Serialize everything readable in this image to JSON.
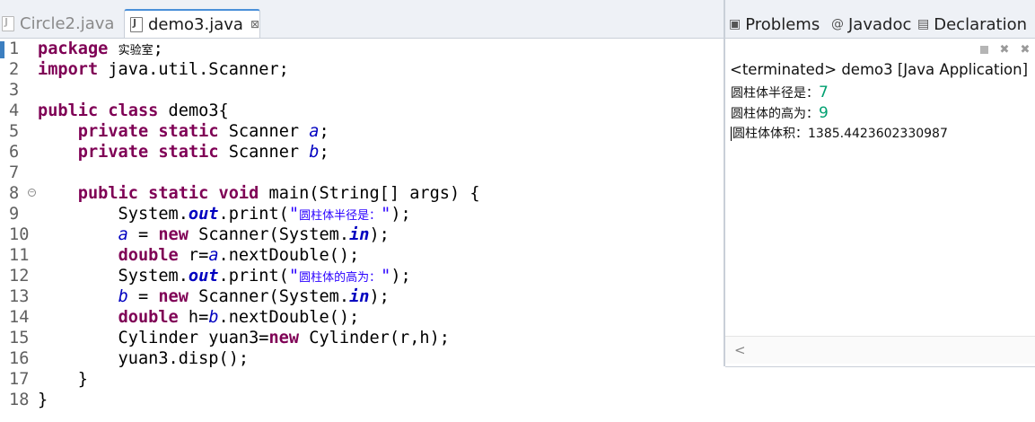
{
  "editor": {
    "tabs": [
      {
        "label": "Circle2.java",
        "icon": "java-file-icon",
        "active": false
      },
      {
        "label": "demo3.java",
        "icon": "java-file-icon",
        "active": true,
        "close": "⊠"
      }
    ],
    "lines": [
      {
        "n": "1",
        "segs": [
          [
            "kw",
            "package"
          ],
          [
            "t",
            " "
          ],
          [
            "cn",
            "实验室"
          ],
          [
            "t",
            ";"
          ]
        ]
      },
      {
        "n": "2",
        "segs": [
          [
            "kw",
            "import"
          ],
          [
            "t",
            " java.util.Scanner;"
          ]
        ]
      },
      {
        "n": "3",
        "segs": []
      },
      {
        "n": "4",
        "segs": [
          [
            "kw",
            "public"
          ],
          [
            "t",
            " "
          ],
          [
            "kw",
            "class"
          ],
          [
            "t",
            " demo3{"
          ]
        ]
      },
      {
        "n": "5",
        "segs": [
          [
            "t",
            "    "
          ],
          [
            "kw",
            "private"
          ],
          [
            "t",
            " "
          ],
          [
            "kw",
            "static"
          ],
          [
            "t",
            " Scanner "
          ],
          [
            "fld",
            "a"
          ],
          [
            "t",
            ";"
          ]
        ]
      },
      {
        "n": "6",
        "segs": [
          [
            "t",
            "    "
          ],
          [
            "kw",
            "private"
          ],
          [
            "t",
            " "
          ],
          [
            "kw",
            "static"
          ],
          [
            "t",
            " Scanner "
          ],
          [
            "fld",
            "b"
          ],
          [
            "t",
            ";"
          ]
        ]
      },
      {
        "n": "7",
        "segs": []
      },
      {
        "n": "8",
        "fold": true,
        "segs": [
          [
            "t",
            "    "
          ],
          [
            "kw",
            "public"
          ],
          [
            "t",
            " "
          ],
          [
            "kw",
            "static"
          ],
          [
            "t",
            " "
          ],
          [
            "kw",
            "void"
          ],
          [
            "t",
            " main(String[] args) {"
          ]
        ]
      },
      {
        "n": "9",
        "segs": [
          [
            "t",
            "        System."
          ],
          [
            "st",
            "out"
          ],
          [
            "t",
            ".print("
          ],
          [
            "str",
            "\""
          ],
          [
            "strcn",
            "圆柱体半径是："
          ],
          [
            "str",
            "\""
          ],
          [
            "t",
            ");"
          ]
        ]
      },
      {
        "n": "10",
        "segs": [
          [
            "t",
            "        "
          ],
          [
            "fld",
            "a"
          ],
          [
            "t",
            " = "
          ],
          [
            "kw",
            "new"
          ],
          [
            "t",
            " Scanner(System."
          ],
          [
            "st",
            "in"
          ],
          [
            "t",
            ");"
          ]
        ]
      },
      {
        "n": "11",
        "segs": [
          [
            "t",
            "        "
          ],
          [
            "kw",
            "double"
          ],
          [
            "t",
            " r="
          ],
          [
            "fld",
            "a"
          ],
          [
            "t",
            ".nextDouble();"
          ]
        ]
      },
      {
        "n": "12",
        "segs": [
          [
            "t",
            "        System."
          ],
          [
            "st",
            "out"
          ],
          [
            "t",
            ".print("
          ],
          [
            "str",
            "\""
          ],
          [
            "strcn",
            "圆柱体的高为："
          ],
          [
            "str",
            "\""
          ],
          [
            "t",
            ");"
          ]
        ]
      },
      {
        "n": "13",
        "segs": [
          [
            "t",
            "        "
          ],
          [
            "fld",
            "b"
          ],
          [
            "t",
            " = "
          ],
          [
            "kw",
            "new"
          ],
          [
            "t",
            " Scanner(System."
          ],
          [
            "st",
            "in"
          ],
          [
            "t",
            ");"
          ]
        ]
      },
      {
        "n": "14",
        "segs": [
          [
            "t",
            "        "
          ],
          [
            "kw",
            "double"
          ],
          [
            "t",
            " h="
          ],
          [
            "fld",
            "b"
          ],
          [
            "t",
            ".nextDouble();"
          ]
        ]
      },
      {
        "n": "15",
        "segs": [
          [
            "t",
            "        Cylinder yuan3="
          ],
          [
            "kw",
            "new"
          ],
          [
            "t",
            " Cylinder(r,h);"
          ]
        ]
      },
      {
        "n": "16",
        "segs": [
          [
            "t",
            "        yuan3.disp();"
          ]
        ]
      },
      {
        "n": "17",
        "segs": [
          [
            "t",
            "    }"
          ]
        ]
      },
      {
        "n": "18",
        "segs": [
          [
            "t",
            "}"
          ]
        ]
      }
    ]
  },
  "view": {
    "tabs": [
      {
        "label": "Problems",
        "icon": "problems-icon"
      },
      {
        "label": "Javadoc",
        "icon": "javadoc-icon"
      },
      {
        "label": "Declaration",
        "icon": "declaration-icon"
      }
    ],
    "toolbar": [
      "stop-icon",
      "remove-launch-icon",
      "remove-all-icon"
    ],
    "terminated": "<terminated> demo3 [Java Application]",
    "output": [
      {
        "prompt": "圆柱体半径是：",
        "input": "7"
      },
      {
        "prompt": "圆柱体的高为：",
        "input": "9"
      },
      {
        "prompt": "圆柱体体积：1385.4423602330987",
        "input": ""
      }
    ]
  }
}
